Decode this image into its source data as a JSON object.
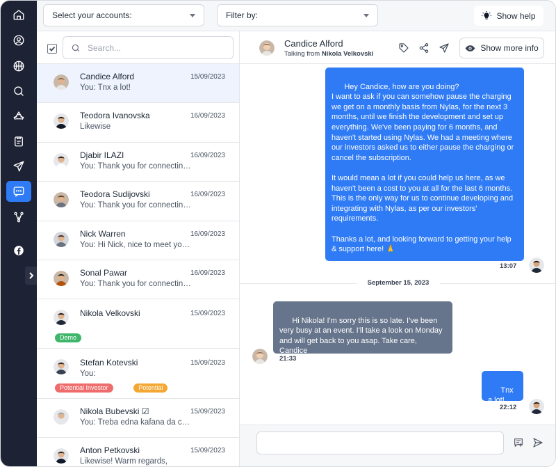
{
  "sidebar": {
    "icons": [
      "home-icon",
      "user-icon",
      "basketball-icon",
      "search-icon",
      "recycle-icon",
      "clipboard-icon",
      "send-icon",
      "chat-icon",
      "graph-icon",
      "facebook-icon"
    ],
    "active": "chat-icon"
  },
  "topbar": {
    "accounts_select": "Select your accounts:",
    "filter_select": "Filter by:",
    "help_label": "Show help"
  },
  "list": {
    "search_placeholder": "Search...",
    "conversations": [
      {
        "name": "Candice Alford",
        "preview": "You: Tnx a lot!",
        "date": "15/09/2023",
        "tags": []
      },
      {
        "name": "Teodora Ivanovska",
        "preview": "Likewise",
        "date": "16/09/2023",
        "tags": []
      },
      {
        "name": "Djabir ILAZI",
        "preview": "You: Thank you for connecting ...",
        "date": "16/09/2023",
        "tags": []
      },
      {
        "name": "Teodora Sudijovski",
        "preview": "You: Thank you for connecting ...",
        "date": "16/09/2023",
        "tags": []
      },
      {
        "name": "Nick Warren",
        "preview": "You: Hi Nick, nice to meet you. ...",
        "date": "16/09/2023",
        "tags": []
      },
      {
        "name": "Sonal Pawar",
        "preview": "You: Thank you for connecting ...",
        "date": "16/09/2023",
        "tags": []
      },
      {
        "name": "Nikola Velkovski",
        "preview": "",
        "date": "15/09/2023",
        "tags": [
          "Demo"
        ]
      },
      {
        "name": "Stefan Kotevski",
        "preview": "You:",
        "date": "15/09/2023",
        "tags": [
          "Potential Investor",
          "Potential"
        ]
      },
      {
        "name": "Nikola Bubevski ☑",
        "preview": "You: Treba edna kafana da cas...",
        "date": "15/09/2023",
        "tags": []
      },
      {
        "name": "Anton Petkovski",
        "preview": "Likewise! Warm regards,",
        "date": "15/09/2023",
        "tags": []
      }
    ],
    "tag_colors": {
      "Demo": "#3fb66a",
      "Potential Investor": "#ef6c6c",
      "Potential": "#f4a733"
    }
  },
  "chat": {
    "contact_name": "Candice Alford",
    "talking_from_prefix": "Talking from",
    "talking_from_name": "Nikola Velkovski",
    "more_info_label": "Show more info",
    "messages": [
      {
        "direction": "out",
        "text": "Hey Candice, how are you doing?\nI want to ask if you can somehow pause the charging we get on a monthly basis from Nylas, for the next 3 months, until we finish the development and set up everything. We've been paying for 6 months, and haven't started using Nylas. We had a meeting where our investors asked us to either pause the charging or cancel the subscription.\n\nIt would mean a lot if you could help us here, as we haven't been a cost to you at all for the last 6 months. This is the only way for us to continue developing and integrating with Nylas, as per our investors' requirements.\n\nThanks a lot, and looking forward to getting your help & support here! 🙏",
        "time": "13:07"
      },
      {
        "direction": "in",
        "text": "Hi Nikola! I'm sorry this is so late. I've been very busy at an event. I'll take a look on Monday and will get back to you asap. Take care, Candice",
        "time": "21:33"
      },
      {
        "direction": "out",
        "text": "Tnx a lot!",
        "time": "22:12"
      }
    ],
    "date_separator": "September 15, 2023",
    "composer_placeholder": ""
  }
}
